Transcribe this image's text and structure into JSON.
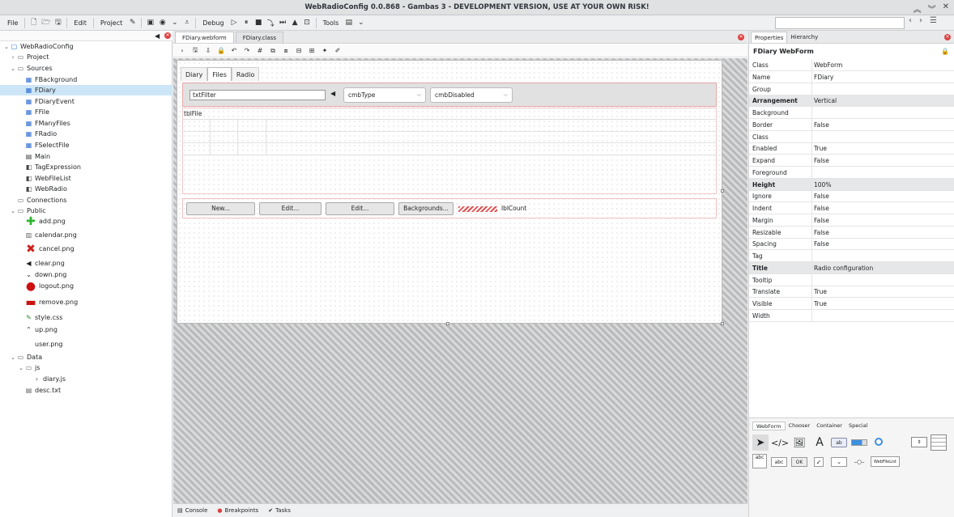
{
  "window": {
    "title": "WebRadioConfig 0.0.868 - Gambas 3 - DEVELOPMENT VERSION, USE AT YOUR OWN RISK!"
  },
  "menu": {
    "file": "File",
    "edit": "Edit",
    "project": "Project",
    "debug": "Debug",
    "tools": "Tools"
  },
  "tree": {
    "items": [
      {
        "label": "WebRadioConfig",
        "icon": "project-icon",
        "level": 0,
        "expanded": true
      },
      {
        "label": "Project",
        "icon": "folder-icon",
        "level": 1,
        "collapsed": true
      },
      {
        "label": "Sources",
        "icon": "folder-icon",
        "level": 1,
        "expanded": true
      },
      {
        "label": "FBackground",
        "icon": "form-icon",
        "level": 2
      },
      {
        "label": "FDiary",
        "icon": "form-icon",
        "level": 2,
        "selected": true
      },
      {
        "label": "FDiaryEvent",
        "icon": "form-icon",
        "level": 2
      },
      {
        "label": "FFile",
        "icon": "form-icon",
        "level": 2
      },
      {
        "label": "FManyFiles",
        "icon": "form-icon",
        "level": 2
      },
      {
        "label": "FRadio",
        "icon": "form-icon",
        "level": 2
      },
      {
        "label": "FSelectFile",
        "icon": "form-icon",
        "level": 2
      },
      {
        "label": "Main",
        "icon": "module-icon",
        "level": 2
      },
      {
        "label": "TagExpression",
        "icon": "class-icon",
        "level": 2
      },
      {
        "label": "WebFileList",
        "icon": "class-icon",
        "level": 2
      },
      {
        "label": "WebRadio",
        "icon": "class-icon",
        "level": 2
      },
      {
        "label": "Connections",
        "icon": "folder-icon",
        "level": 1
      },
      {
        "label": "Public",
        "icon": "folder-icon",
        "level": 1,
        "expanded": true
      },
      {
        "label": "add.png",
        "icon": "add-image-icon",
        "level": 2
      },
      {
        "label": "calendar.png",
        "icon": "calendar-image-icon",
        "level": 2
      },
      {
        "label": "cancel.png",
        "icon": "cancel-image-icon",
        "level": 2
      },
      {
        "label": "clear.png",
        "icon": "clear-image-icon",
        "level": 2
      },
      {
        "label": "down.png",
        "icon": "down-image-icon",
        "level": 2
      },
      {
        "label": "logout.png",
        "icon": "logout-image-icon",
        "level": 2
      },
      {
        "label": "remove.png",
        "icon": "remove-image-icon",
        "level": 2
      },
      {
        "label": "style.css",
        "icon": "css-file-icon",
        "level": 2
      },
      {
        "label": "up.png",
        "icon": "up-image-icon",
        "level": 2
      },
      {
        "label": "user.png",
        "icon": "user-image-icon",
        "level": 2
      },
      {
        "label": "Data",
        "icon": "folder-icon",
        "level": 1,
        "expanded": true
      },
      {
        "label": "js",
        "icon": "folder-icon",
        "level": 2,
        "expanded": true
      },
      {
        "label": "diary.js",
        "icon": "script-file-icon",
        "level": 3
      },
      {
        "label": "desc.txt",
        "icon": "text-file-icon",
        "level": 2
      }
    ]
  },
  "editor": {
    "tabs": [
      {
        "label": "FDiary.webform",
        "active": true
      },
      {
        "label": "FDiary.class",
        "active": false
      }
    ]
  },
  "form": {
    "tabs": [
      "Diary",
      "Files",
      "Radio"
    ],
    "active_tab": "Files",
    "txtFilter": "txtFilter",
    "cmbType": "cmbType",
    "cmbDisabled": "cmbDisabled",
    "tblFile": "tblFile",
    "buttons": {
      "new": "New...",
      "edit1": "Edit...",
      "edit2": "Edit...",
      "backgrounds": "Backgrounds..."
    },
    "lblCount": "lblCount"
  },
  "bottom": {
    "console": "Console",
    "breakpoints": "Breakpoints",
    "tasks": "Tasks"
  },
  "right": {
    "tabs": {
      "properties": "Properties",
      "hierarchy": "Hierarchy"
    },
    "object": "FDiary WebForm",
    "properties": [
      {
        "name": "Class",
        "value": "WebForm"
      },
      {
        "name": "Name",
        "value": "FDiary"
      },
      {
        "name": "Group",
        "value": ""
      },
      {
        "name": "Arrangement",
        "value": "Vertical",
        "bold": true
      },
      {
        "name": "Background",
        "value": ""
      },
      {
        "name": "Border",
        "value": "False"
      },
      {
        "name": "Class",
        "value": ""
      },
      {
        "name": "Enabled",
        "value": "True"
      },
      {
        "name": "Expand",
        "value": "False"
      },
      {
        "name": "Foreground",
        "value": ""
      },
      {
        "name": "Height",
        "value": "100%",
        "bold": true
      },
      {
        "name": "Ignore",
        "value": "False"
      },
      {
        "name": "Indent",
        "value": "False"
      },
      {
        "name": "Margin",
        "value": "False"
      },
      {
        "name": "Resizable",
        "value": "False"
      },
      {
        "name": "Spacing",
        "value": "False"
      },
      {
        "name": "Tag",
        "value": ""
      },
      {
        "name": "Title",
        "value": "Radio configuration",
        "bold": true
      },
      {
        "name": "Tooltip",
        "value": ""
      },
      {
        "name": "Translate",
        "value": "True"
      },
      {
        "name": "Visible",
        "value": "True"
      },
      {
        "name": "Width",
        "value": ""
      }
    ],
    "toolbox_tabs": [
      "WebForm",
      "Chooser",
      "Container",
      "Special"
    ],
    "toolbox_samples": {
      "textarea": "abc",
      "textbox": "abc",
      "button": "OK",
      "filelist": "WebFileList",
      "label": "A"
    }
  }
}
